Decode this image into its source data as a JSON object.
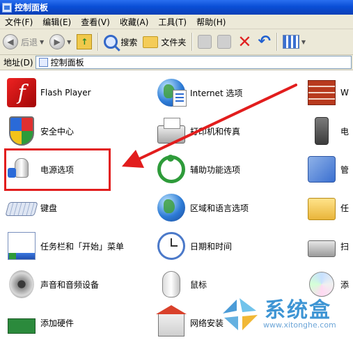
{
  "window": {
    "title": "控制面板"
  },
  "menu": [
    "文件(F)",
    "编辑(E)",
    "查看(V)",
    "收藏(A)",
    "工具(T)",
    "帮助(H)"
  ],
  "toolbar": {
    "back_label": "后退",
    "search_label": "搜索",
    "folders_label": "文件夹"
  },
  "address": {
    "label": "地址(D)",
    "value": "控制面板"
  },
  "items": {
    "flash": "Flash Player",
    "internet": "Internet 选项",
    "firewall": "W",
    "security": "安全中心",
    "printers": "打印机和传真",
    "phone": "电",
    "power": "电源选项",
    "accessibility": "辅助功能选项",
    "admin": "管",
    "keyboard": "键盘",
    "regional": "区域和语言选项",
    "folderopt": "任",
    "taskbar": "任务栏和「开始」菜单",
    "datetime": "日期和时间",
    "scanner": "扫",
    "sound": "声音和音频设备",
    "mouse": "鼠标",
    "addremove": "添",
    "hardware": "添加硬件",
    "network": "网络安装"
  },
  "watermark": {
    "title": "系统盒",
    "url": "www.xitonghe.com"
  },
  "colors": {
    "highlight": "#e21d1d",
    "titlebar": "#0a4fd6"
  }
}
